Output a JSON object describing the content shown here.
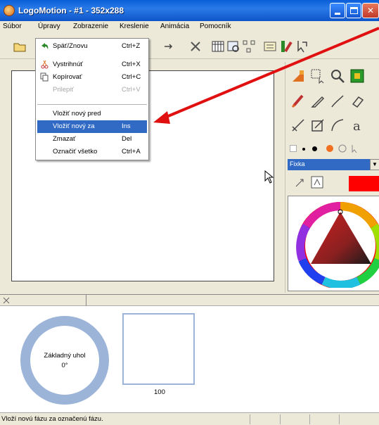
{
  "window": {
    "title": "LogoMotion - #1 - 352x288",
    "icon": "app-logo-icon"
  },
  "menubar": {
    "items": [
      "Súbor",
      "Úpravy",
      "Zobrazenie",
      "Kreslenie",
      "Animácia",
      "Pomocník"
    ]
  },
  "edit_menu": {
    "items": [
      {
        "label": "Späť/Znovu",
        "shortcut": "Ctrl+Z",
        "icon": "undo-icon",
        "enabled": true
      },
      {
        "label": "Vystrihnúť",
        "shortcut": "Ctrl+X",
        "icon": "cut-icon",
        "enabled": true
      },
      {
        "label": "Kopírovať",
        "shortcut": "Ctrl+C",
        "icon": "copy-icon",
        "enabled": true
      },
      {
        "label": "Prilepiť",
        "shortcut": "Ctrl+V",
        "icon": "",
        "enabled": false
      },
      {
        "label": "Vložiť nový pred",
        "shortcut": "",
        "enabled": true
      },
      {
        "label": "Vložiť nový za",
        "shortcut": "Ins",
        "enabled": true,
        "highlighted": true
      },
      {
        "label": "Zmazať",
        "shortcut": "Del",
        "enabled": true
      },
      {
        "label": "Označiť všetko",
        "shortcut": "Ctrl+A",
        "enabled": true
      }
    ]
  },
  "right_panel": {
    "brush_type": "Fixka",
    "current_color": "#ff0000"
  },
  "timeline": {
    "angle_label": "Základný uhol",
    "angle_value": "0°",
    "frame_number": "100"
  },
  "status_bar": {
    "text": "Vloží novú fázu za označenú fázu."
  },
  "colors": {
    "highlight": "#316ac5",
    "annotation_arrow": "#e01010",
    "titlebar": "#0a5fd8"
  }
}
